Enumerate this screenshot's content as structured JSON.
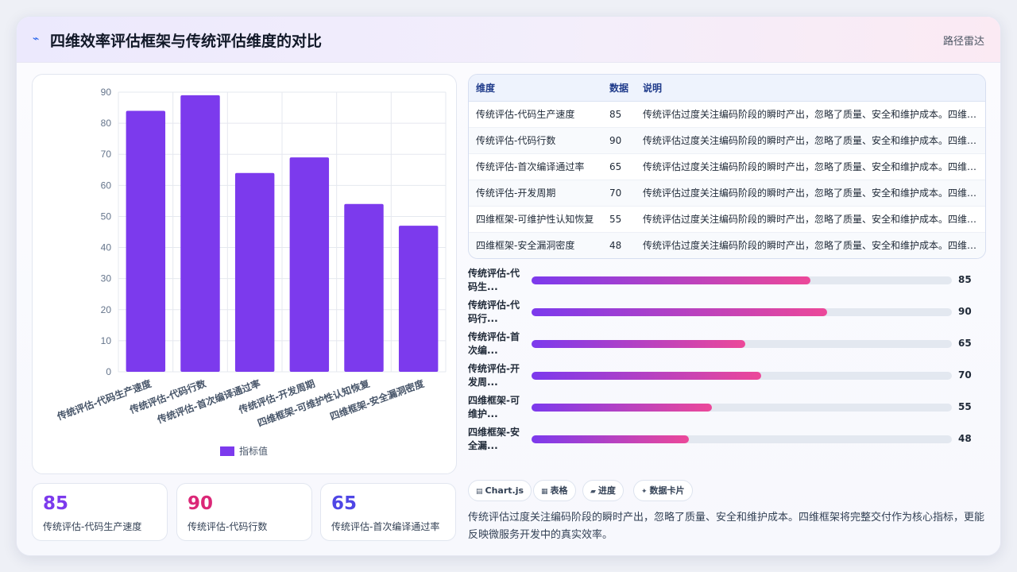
{
  "header": {
    "icon": "trend-icon",
    "title": "四维效率评估框架与传统评估维度的对比",
    "tag": "路径雷达"
  },
  "chart_data": {
    "type": "bar",
    "categories": [
      "传统评估-代码生产速度",
      "传统评估-代码行数",
      "传统评估-首次编译通过率",
      "传统评估-开发周期",
      "四维框架-可维护性认知恢复",
      "四维框架-安全漏洞密度"
    ],
    "series": [
      {
        "name": "指标值",
        "values": [
          84,
          89,
          64,
          69,
          54,
          47
        ]
      }
    ],
    "ylim": [
      0,
      90
    ],
    "yticks": [
      0,
      10,
      20,
      30,
      40,
      50,
      60,
      70,
      80,
      90
    ],
    "grid": true,
    "legend": "bottom",
    "color": "#7c3aed"
  },
  "stats": [
    {
      "value": "85",
      "label": "传统评估-代码生产速度",
      "color": "#7c3aed"
    },
    {
      "value": "90",
      "label": "传统评估-代码行数",
      "color": "#db2777"
    },
    {
      "value": "65",
      "label": "传统评估-首次编译通过率",
      "color": "#4f46e5"
    }
  ],
  "table": {
    "headers": [
      "维度",
      "数据",
      "说明"
    ],
    "rows": [
      {
        "dim": "传统评估-代码生产速度",
        "val": "85",
        "desc": "传统评估过度关注编码阶段的瞬时产出，忽略了质量、安全和维护成本。四维框架将完整交付作为核心指标"
      },
      {
        "dim": "传统评估-代码行数",
        "val": "90",
        "desc": "传统评估过度关注编码阶段的瞬时产出，忽略了质量、安全和维护成本。四维框架将完整交付作为核心指标"
      },
      {
        "dim": "传统评估-首次编译通过率",
        "val": "65",
        "desc": "传统评估过度关注编码阶段的瞬时产出，忽略了质量、安全和维护成本。四维框架将完整交付作为核心指标"
      },
      {
        "dim": "传统评估-开发周期",
        "val": "70",
        "desc": "传统评估过度关注编码阶段的瞬时产出，忽略了质量、安全和维护成本。四维框架将完整交付作为核心指标"
      },
      {
        "dim": "四维框架-可维护性认知恢复",
        "val": "55",
        "desc": "传统评估过度关注编码阶段的瞬时产出，忽略了质量、安全和维护成本。四维框架将完整交付作为核心指标"
      },
      {
        "dim": "四维框架-安全漏洞密度",
        "val": "48",
        "desc": "传统评估过度关注编码阶段的瞬时产出，忽略了质量、安全和维护成本。四维框架将完整交付作为核心指标"
      }
    ]
  },
  "progress": [
    {
      "label": "传统评估-代码生...",
      "value": 85,
      "text": "85"
    },
    {
      "label": "传统评估-代码行...",
      "value": 90,
      "text": "90"
    },
    {
      "label": "传统评估-首次编...",
      "value": 65,
      "text": "65"
    },
    {
      "label": "传统评估-开发周...",
      "value": 70,
      "text": "70"
    },
    {
      "label": "四维框架-可维护...",
      "value": 55,
      "text": "55"
    },
    {
      "label": "四维框架-安全漏...",
      "value": 48,
      "text": "48"
    }
  ],
  "progress_max": 128,
  "chips": [
    {
      "icon": "chart-icon",
      "glyph": "▤",
      "label": "Chart.js"
    },
    {
      "icon": "table-icon",
      "glyph": "▦",
      "label": "表格"
    },
    {
      "icon": "progress-icon",
      "glyph": "▰",
      "label": "进度"
    },
    {
      "icon": "card-icon",
      "glyph": "✦",
      "label": "数据卡片"
    }
  ],
  "summary": "传统评估过度关注编码阶段的瞬时产出，忽略了质量、安全和维护成本。四维框架将完整交付作为核心指标，更能反映微服务开发中的真实效率。"
}
